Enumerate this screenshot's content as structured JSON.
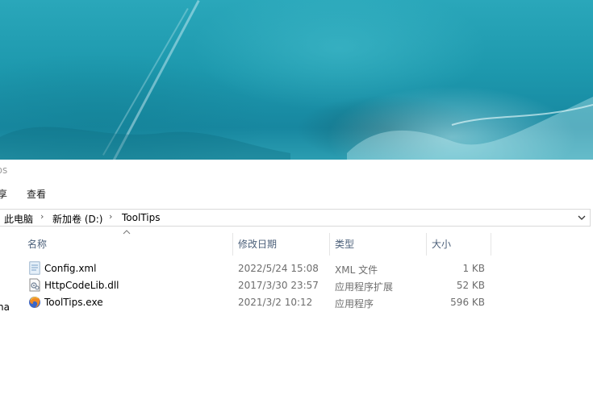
{
  "window": {
    "title_fragment": "ips"
  },
  "ribbon": {
    "tab_partial": "享",
    "tab_view": "查看"
  },
  "address": {
    "crumbs": [
      "此电脑",
      "新加卷 (D:)",
      "ToolTips"
    ]
  },
  "columns": {
    "name": "名称",
    "modified": "修改日期",
    "type": "类型",
    "size": "大小"
  },
  "files": [
    {
      "name": "Config.xml",
      "modified": "2022/5/24 15:08",
      "type": "XML 文件",
      "size": "1 KB",
      "icon": "xml-file-icon"
    },
    {
      "name": "HttpCodeLib.dll",
      "modified": "2017/3/30 23:57",
      "type": "应用程序扩展",
      "size": "52 KB",
      "icon": "dll-file-icon"
    },
    {
      "name": "ToolTips.exe",
      "modified": "2021/3/2 10:12",
      "type": "应用程序",
      "size": "596 KB",
      "icon": "firefox-exe-icon"
    }
  ],
  "nav_pane": {
    "fragment": "na"
  }
}
